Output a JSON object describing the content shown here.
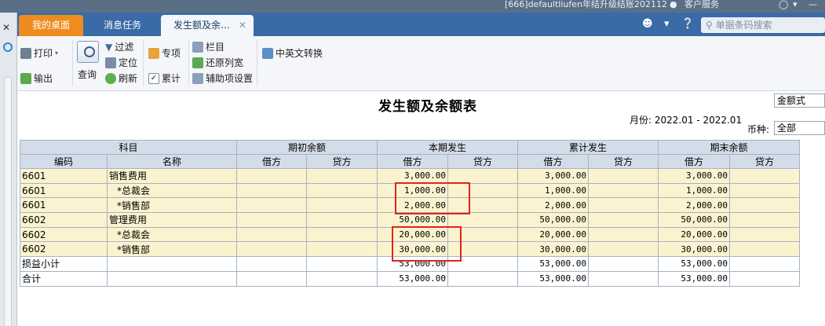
{
  "sysbar": {
    "context": "[666]defaultliufen年结升级结账202112",
    "service": "客户服务"
  },
  "tabs": [
    {
      "label": "我的桌面"
    },
    {
      "label": "消息任务"
    },
    {
      "label": "发生额及余…"
    }
  ],
  "search": {
    "placeholder": "单据条码搜索"
  },
  "toolbar": {
    "print": "打印",
    "export": "输出",
    "query": "查询",
    "filter": "过滤",
    "locate": "定位",
    "refresh": "刷新",
    "special": "专项",
    "cumulative": "累计",
    "columns": "栏目",
    "restore_width": "还原列宽",
    "aux_settings": "辅助项设置",
    "lang_switch": "中英文转换"
  },
  "report": {
    "title": "发生额及余额表",
    "format": "金额式",
    "period_label": "月份:",
    "period_value": "2022.01 - 2022.01",
    "currency_label": "币种:",
    "currency_value": "全部"
  },
  "table": {
    "group_headers": [
      "科目",
      "期初余额",
      "本期发生",
      "累计发生",
      "期末余额"
    ],
    "sub_headers": [
      "编码",
      "名称",
      "借方",
      "贷方",
      "借方",
      "贷方",
      "借方",
      "贷方",
      "借方",
      "贷方"
    ],
    "rows": [
      {
        "code": "6601",
        "name": "销售费用",
        "indent": false,
        "open_dr": "",
        "open_cr": "",
        "cur_dr": "3,000.00",
        "cur_cr": "",
        "cum_dr": "3,000.00",
        "cum_cr": "",
        "end_dr": "3,000.00",
        "end_cr": "",
        "sum": false
      },
      {
        "code": "6601",
        "name": "*总裁会",
        "indent": true,
        "open_dr": "",
        "open_cr": "",
        "cur_dr": "1,000.00",
        "cur_cr": "",
        "cum_dr": "1,000.00",
        "cum_cr": "",
        "end_dr": "1,000.00",
        "end_cr": "",
        "sum": false
      },
      {
        "code": "6601",
        "name": "*销售部",
        "indent": true,
        "open_dr": "",
        "open_cr": "",
        "cur_dr": "2,000.00",
        "cur_cr": "",
        "cum_dr": "2,000.00",
        "cum_cr": "",
        "end_dr": "2,000.00",
        "end_cr": "",
        "sum": false
      },
      {
        "code": "6602",
        "name": "管理费用",
        "indent": false,
        "open_dr": "",
        "open_cr": "",
        "cur_dr": "50,000.00",
        "cur_cr": "",
        "cum_dr": "50,000.00",
        "cum_cr": "",
        "end_dr": "50,000.00",
        "end_cr": "",
        "sum": false
      },
      {
        "code": "6602",
        "name": "*总裁会",
        "indent": true,
        "open_dr": "",
        "open_cr": "",
        "cur_dr": "20,000.00",
        "cur_cr": "",
        "cum_dr": "20,000.00",
        "cum_cr": "",
        "end_dr": "20,000.00",
        "end_cr": "",
        "sum": false
      },
      {
        "code": "6602",
        "name": "*销售部",
        "indent": true,
        "open_dr": "",
        "open_cr": "",
        "cur_dr": "30,000.00",
        "cur_cr": "",
        "cum_dr": "30,000.00",
        "cum_cr": "",
        "end_dr": "30,000.00",
        "end_cr": "",
        "sum": false
      },
      {
        "code": "损益小计",
        "name": "",
        "indent": false,
        "open_dr": "",
        "open_cr": "",
        "cur_dr": "53,000.00",
        "cur_cr": "",
        "cum_dr": "53,000.00",
        "cum_cr": "",
        "end_dr": "53,000.00",
        "end_cr": "",
        "sum": true
      },
      {
        "code": "合计",
        "name": "",
        "indent": false,
        "open_dr": "",
        "open_cr": "",
        "cur_dr": "53,000.00",
        "cur_cr": "",
        "cum_dr": "53,000.00",
        "cum_cr": "",
        "end_dr": "53,000.00",
        "end_cr": "",
        "sum": true
      }
    ]
  },
  "colors": {
    "tab_active_home": "#ee8c20",
    "tabbar_bg": "#3a6aa7",
    "row_bg": "#fbf3cf",
    "header_bg": "#d3dde9",
    "highlight": "#e0241e"
  }
}
